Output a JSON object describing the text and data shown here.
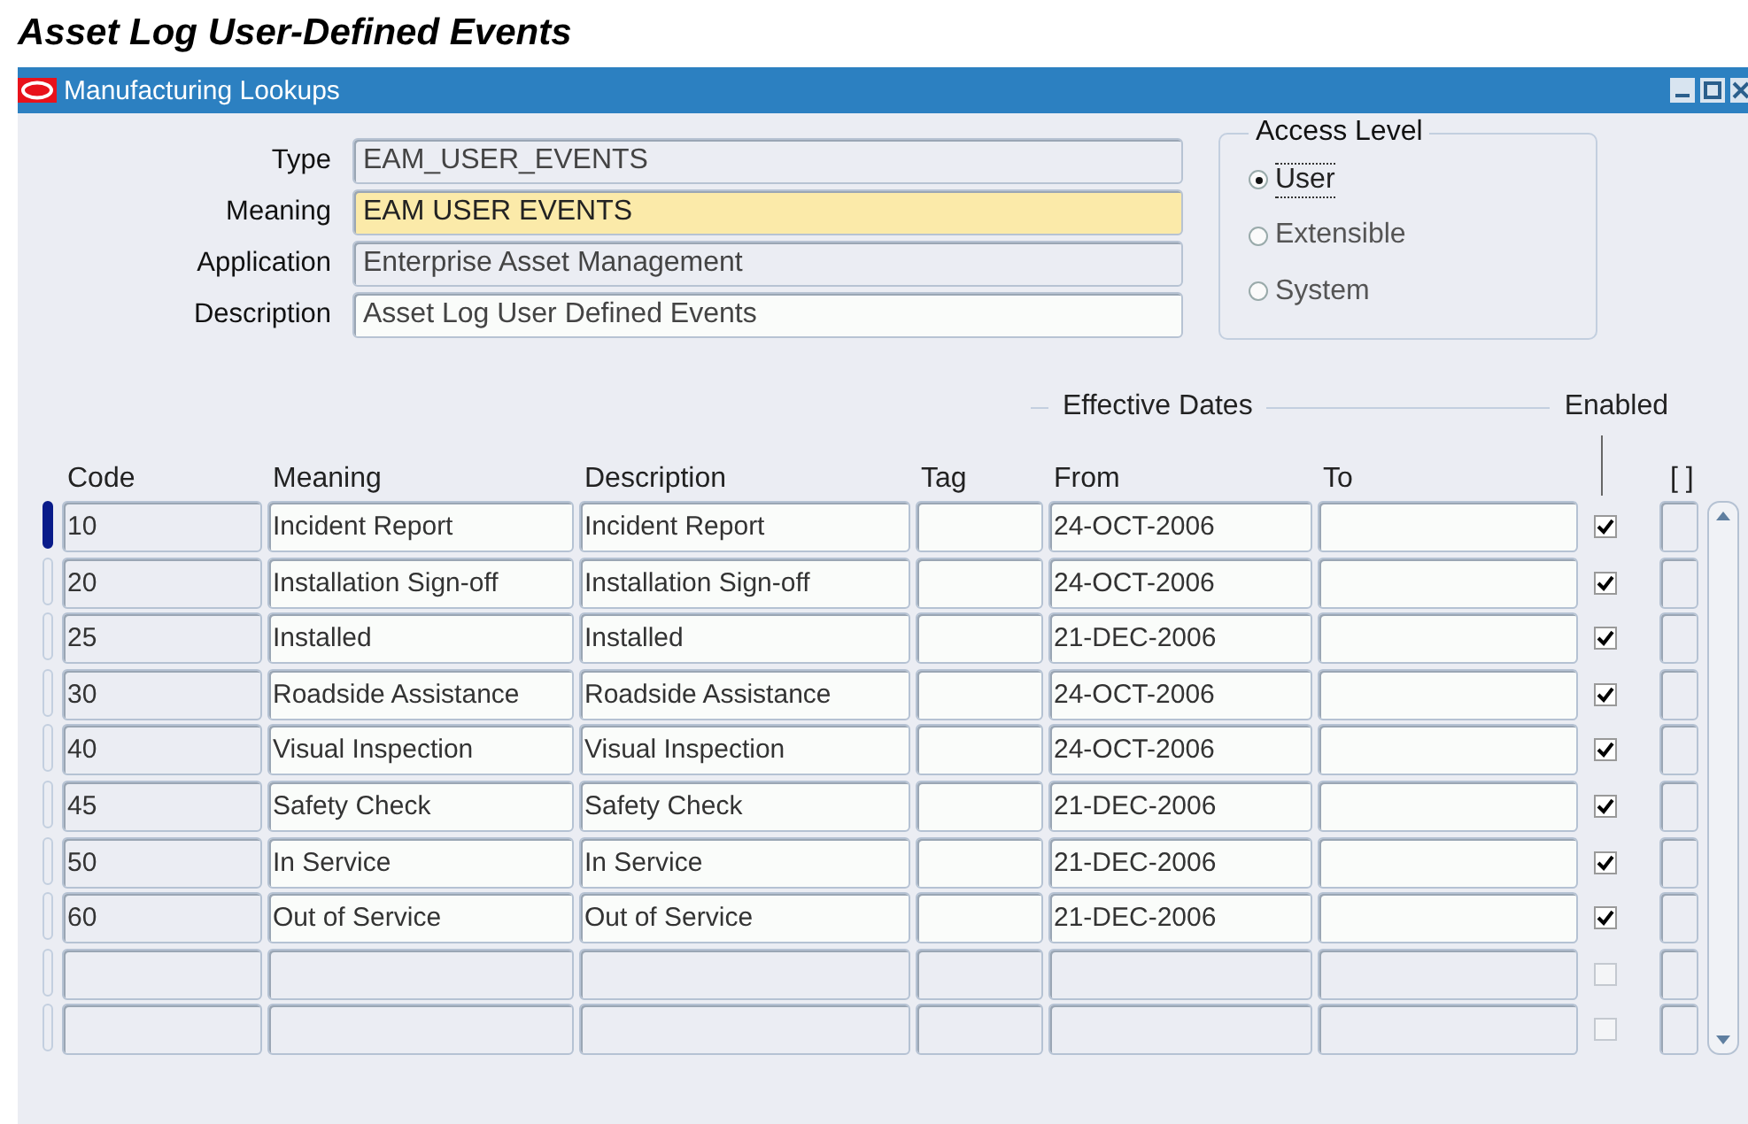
{
  "page_title": "Asset Log User-Defined Events",
  "window": {
    "title": "Manufacturing Lookups"
  },
  "header_fields": [
    {
      "label": "Type",
      "value": "EAM_USER_EVENTS",
      "kind": "readonly"
    },
    {
      "label": "Meaning",
      "value": "EAM USER EVENTS",
      "kind": "current"
    },
    {
      "label": "Application",
      "value": "Enterprise Asset Management",
      "kind": "readonly"
    },
    {
      "label": "Description",
      "value": "Asset Log User Defined Events",
      "kind": "editable"
    }
  ],
  "access_level": {
    "title": "Access Level",
    "options": [
      {
        "label": "User",
        "selected": true
      },
      {
        "label": "Extensible",
        "selected": false
      },
      {
        "label": "System",
        "selected": false
      }
    ]
  },
  "table": {
    "group_label": "Effective Dates",
    "enabled_label": "Enabled",
    "flex_label": "[ ]",
    "columns": [
      "Code",
      "Meaning",
      "Description",
      "Tag",
      "From",
      "To"
    ],
    "rows": [
      {
        "code": "10",
        "meaning": "Incident Report",
        "description": "Incident Report",
        "from": "24-OCT-2006",
        "enabled": true,
        "selected": true
      },
      {
        "code": "20",
        "meaning": "Installation Sign-off",
        "description": "Installation Sign-off",
        "from": "24-OCT-2006",
        "enabled": true,
        "selected": false
      },
      {
        "code": "25",
        "meaning": "Installed",
        "description": "Installed",
        "from": "21-DEC-2006",
        "enabled": true,
        "selected": false
      },
      {
        "code": "30",
        "meaning": "Roadside Assistance",
        "description": "Roadside Assistance",
        "from": "24-OCT-2006",
        "enabled": true,
        "selected": false
      },
      {
        "code": "40",
        "meaning": "Visual Inspection",
        "description": "Visual Inspection",
        "from": "24-OCT-2006",
        "enabled": true,
        "selected": false
      },
      {
        "code": "45",
        "meaning": "Safety Check",
        "description": "Safety Check",
        "from": "21-DEC-2006",
        "enabled": true,
        "selected": false
      },
      {
        "code": "50",
        "meaning": "In Service",
        "description": "In Service",
        "from": "21-DEC-2006",
        "enabled": true,
        "selected": false
      },
      {
        "code": "60",
        "meaning": "Out of Service",
        "description": "Out of Service",
        "from": "21-DEC-2006",
        "enabled": true,
        "selected": false
      },
      {
        "enabled": false,
        "selected": false,
        "kind": "blank"
      },
      {
        "enabled": false,
        "selected": false,
        "kind": "blank"
      }
    ]
  }
}
